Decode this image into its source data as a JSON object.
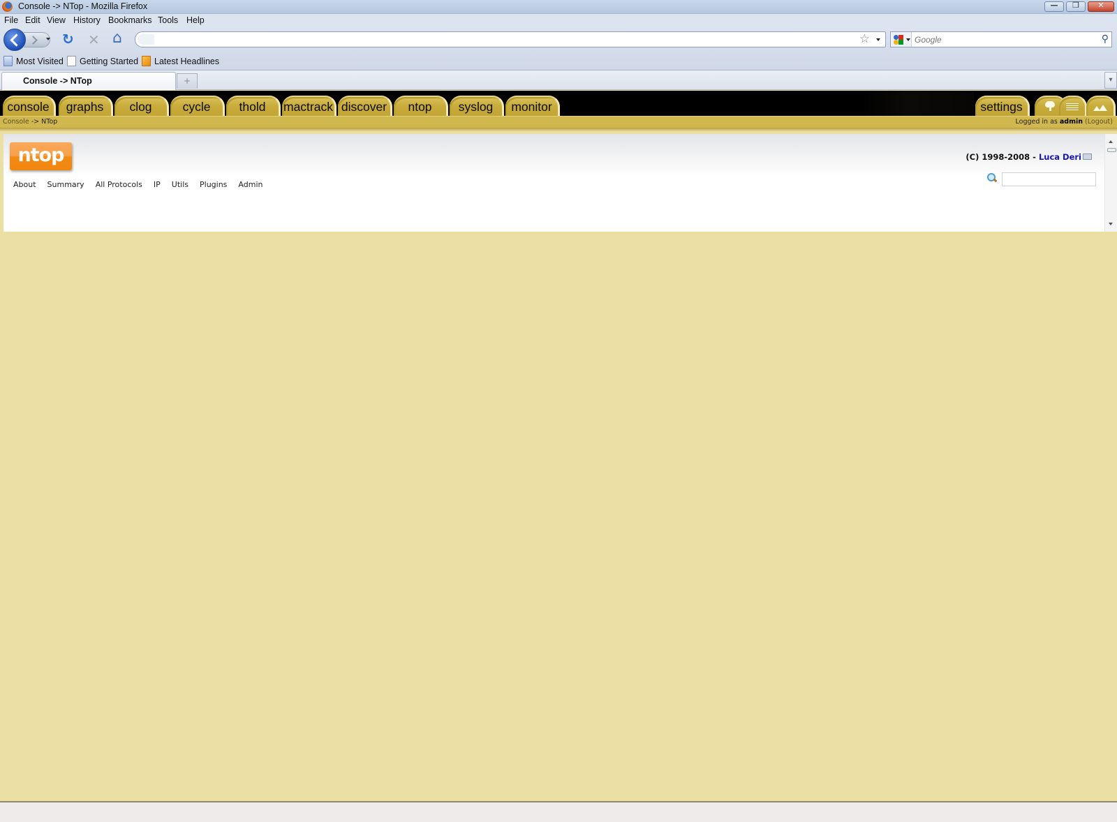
{
  "window": {
    "title": "Console -> NTop - Mozilla Firefox",
    "controls": {
      "minimize": "—",
      "restore": "❐",
      "close": "✕"
    }
  },
  "menubar": {
    "items": [
      {
        "label": "File",
        "accel": "F"
      },
      {
        "label": "Edit",
        "accel": "E"
      },
      {
        "label": "View",
        "accel": "V"
      },
      {
        "label": "History",
        "accel": "s"
      },
      {
        "label": "Bookmarks",
        "accel": "B"
      },
      {
        "label": "Tools",
        "accel": "T"
      },
      {
        "label": "Help",
        "accel": "H"
      }
    ]
  },
  "navbar": {
    "url_value": "",
    "search_placeholder": "Google",
    "search_value": "",
    "icons": {
      "back": "back-icon",
      "forward": "forward-icon",
      "reload": "↻",
      "stop": "✕",
      "home": "⌂",
      "star": "☆",
      "search_go": "⚲"
    }
  },
  "bookmarks": [
    {
      "label": "Most Visited",
      "icon": "most-visited-icon"
    },
    {
      "label": "Getting Started",
      "icon": "page-icon"
    },
    {
      "label": "Latest Headlines",
      "icon": "rss-icon"
    }
  ],
  "browser_tabs": {
    "active": "Console -> NTop",
    "new_tab": "+",
    "list_all": "▾"
  },
  "cacti": {
    "tabs": [
      "console",
      "graphs",
      "clog",
      "cycle",
      "thold",
      "mactrack",
      "discover",
      "ntop",
      "syslog",
      "monitor"
    ],
    "right_tabs": {
      "settings": "settings",
      "icon_tabs": [
        "tree-view-icon",
        "list-view-icon",
        "preview-graph-icon"
      ]
    },
    "breadcrumb": {
      "root": "Console",
      "sep": " -> ",
      "current": "NTop"
    },
    "login": {
      "prefix": "Logged in as ",
      "user": "admin",
      "logout": "(Logout)"
    }
  },
  "ntop": {
    "logo": "ntop",
    "nav": [
      "About",
      "Summary",
      "All Protocols",
      "IP",
      "Utils",
      "Plugins",
      "Admin"
    ],
    "copyright": {
      "text": "(C) 1998-2008 - ",
      "author": "Luca Deri"
    },
    "search_value": ""
  },
  "colors": {
    "page_bg": "#ebdfa4",
    "tab_gold": "#c9ad3c",
    "crumb_bar": "#d1b84e",
    "ntop_orange": "#f38a14",
    "link_blue": "#1414b8"
  }
}
